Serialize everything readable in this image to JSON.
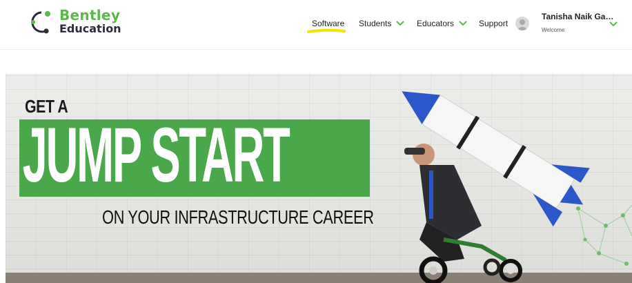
{
  "brand": {
    "line1": "Bentley",
    "line2": "Education",
    "color": "#5cb84a"
  },
  "nav": {
    "software": "Software",
    "students": "Students",
    "educators": "Educators",
    "support": "Support"
  },
  "user": {
    "name": "Tanisha Naik Gau...",
    "subtitle": "Welcome"
  },
  "hero": {
    "line1": "GET A",
    "line2": "JUMP START",
    "line3": "ON YOUR INFRASTRUCTURE CAREER",
    "accent": "#4aa84a"
  },
  "colors": {
    "chevron": "#5cb84a",
    "highlight": "#f5e400",
    "rocket_blue": "#2a57c9"
  },
  "icons": [
    "bentley-logo-icon",
    "chevron-down-icon",
    "user-avatar-icon"
  ]
}
